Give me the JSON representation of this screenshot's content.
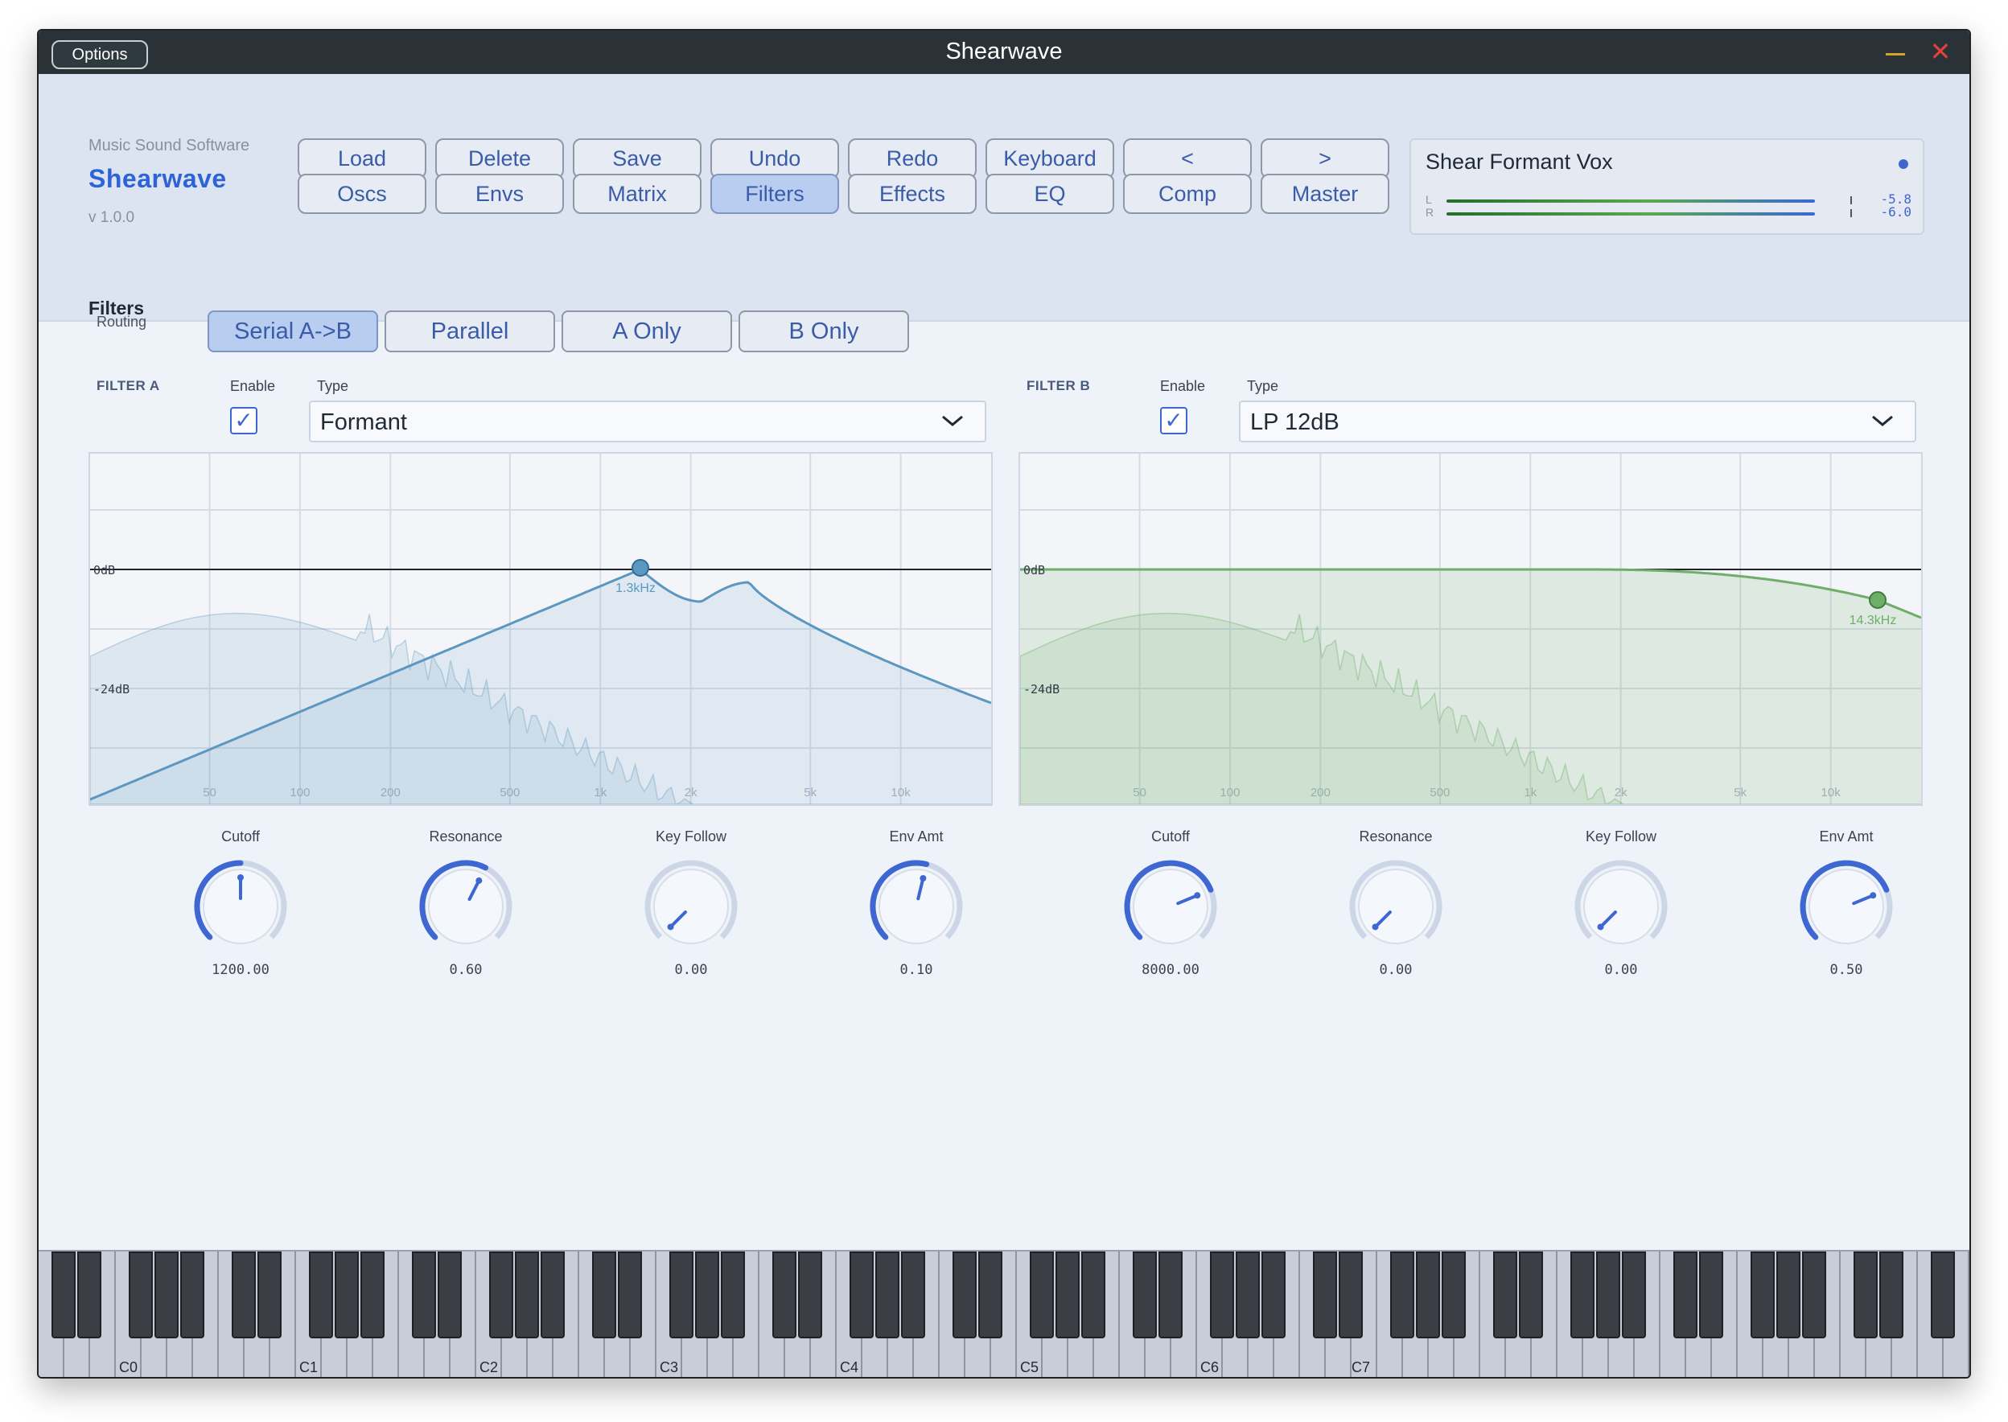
{
  "window": {
    "title": "Shearwave",
    "options_label": "Options",
    "minimize_symbol": "—",
    "close_symbol": "✕"
  },
  "brand": {
    "small": "Music Sound Software",
    "logo": "Shearwave",
    "version": "v 1.0.0"
  },
  "nav": {
    "row1": [
      "Load",
      "Delete",
      "Save",
      "Undo",
      "Redo",
      "Keyboard",
      "<",
      ">"
    ],
    "row2": [
      "Oscs",
      "Envs",
      "Matrix",
      "Filters",
      "Effects",
      "EQ",
      "Comp",
      "Master"
    ],
    "active": "Filters"
  },
  "preset": {
    "name": "Shear Formant Vox",
    "meter": {
      "left_label": "L",
      "right_label": "R",
      "left_value": "-5.8",
      "right_value": "-6.0"
    }
  },
  "section_title": "Filters",
  "routing": {
    "label": "Routing",
    "options": [
      "Serial A->B",
      "Parallel",
      "A Only",
      "B Only"
    ],
    "active": "Serial A->B"
  },
  "filter_a": {
    "title": "FILTER A",
    "enable_label": "Enable",
    "enabled": true,
    "type_label": "Type",
    "type": "Formant",
    "graph": {
      "zero_db": "0dB",
      "minus24_db": "-24dB",
      "freq_labels": [
        "50",
        "100",
        "200",
        "500",
        "1k",
        "2k",
        "5k",
        "10k"
      ],
      "marker_label": "1.3kHz"
    },
    "knobs": [
      {
        "label": "Cutoff",
        "value": "1200.00",
        "level": 0.5,
        "ring": 0.5
      },
      {
        "label": "Resonance",
        "value": "0.60",
        "level": 0.6,
        "ring": 0.6
      },
      {
        "label": "Key Follow",
        "value": "0.00",
        "level": 0.0,
        "ring": 0.0
      },
      {
        "label": "Env Amt",
        "value": "0.10",
        "level": 0.55,
        "ring": 0.55
      }
    ],
    "color": "#5b97c0"
  },
  "filter_b": {
    "title": "FILTER B",
    "enable_label": "Enable",
    "enabled": true,
    "type_label": "Type",
    "type": "LP 12dB",
    "graph": {
      "zero_db": "0dB",
      "minus24_db": "-24dB",
      "freq_labels": [
        "50",
        "100",
        "200",
        "500",
        "1k",
        "2k",
        "5k",
        "10k"
      ],
      "marker_label": "14.3kHz"
    },
    "knobs": [
      {
        "label": "Cutoff",
        "value": "8000.00",
        "level": 0.75,
        "ring": 0.75
      },
      {
        "label": "Resonance",
        "value": "0.00",
        "level": 0.0,
        "ring": 0.0
      },
      {
        "label": "Key Follow",
        "value": "0.00",
        "level": 0.0,
        "ring": 0.0
      },
      {
        "label": "Env Amt",
        "value": "0.50",
        "level": 0.75,
        "ring": 0.75
      }
    ],
    "color": "#6fae69"
  },
  "keyboard": {
    "octave_labels": [
      "C0",
      "C1",
      "C2",
      "C3",
      "C4",
      "C5",
      "C6",
      "C7"
    ]
  },
  "colors": {
    "accent": "#3e67d2",
    "filter_a": "#5b97c0",
    "filter_b": "#6fae69"
  }
}
